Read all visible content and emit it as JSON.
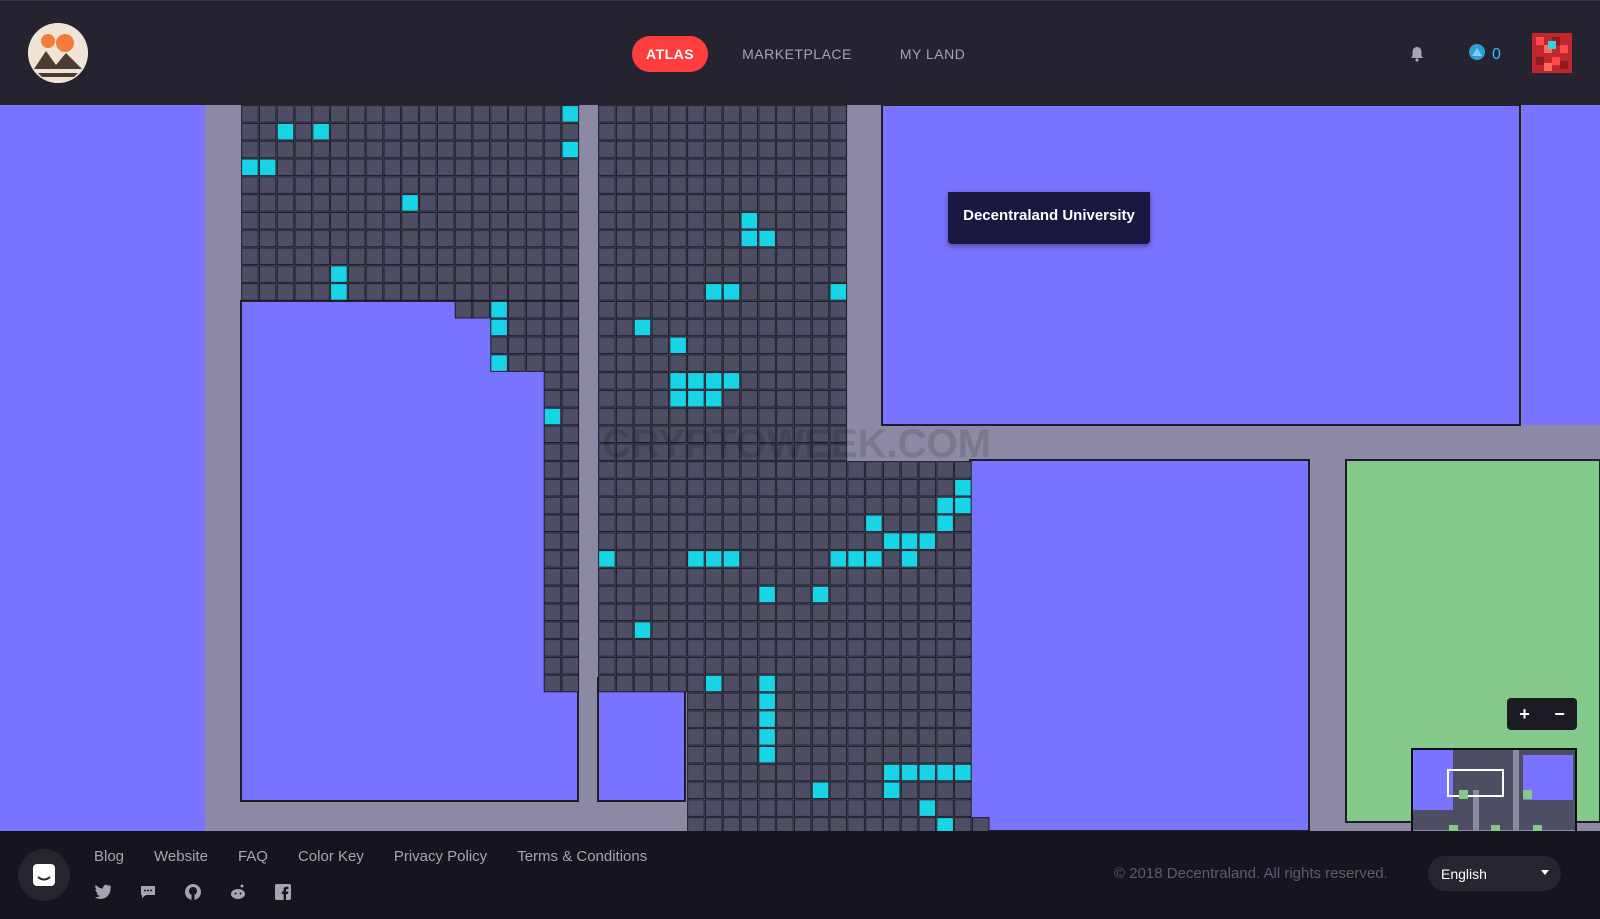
{
  "header": {
    "logo_icon": "decentraland-logo-icon",
    "nav": [
      {
        "label": "ATLAS",
        "active": true
      },
      {
        "label": "MARKETPLACE",
        "active": false
      },
      {
        "label": "MY LAND",
        "active": false
      }
    ],
    "notification_icon": "bell-icon",
    "mana_icon": "mana-icon",
    "mana_balance": "0",
    "avatar_icon": "user-avatar-icon"
  },
  "map": {
    "tooltip": "Decentraland University",
    "watermark": "CRYPTOWEEK.COM",
    "colors": {
      "road": "#8b89a3",
      "district": "#7874ff",
      "plaza": "#82c98a",
      "parcel": "#4d4d63",
      "parcel_border": "#1e1d29",
      "owned_highlight": "#17d4e6"
    },
    "zoom_in_label": "+",
    "zoom_out_label": "−",
    "minimap_icon": "minimap-icon"
  },
  "footer": {
    "chat_icon": "chat-icon",
    "links": [
      "Blog",
      "Website",
      "FAQ",
      "Color Key",
      "Privacy Policy",
      "Terms & Conditions"
    ],
    "social_icons": [
      "twitter-icon",
      "chat-bubble-icon",
      "github-icon",
      "reddit-icon",
      "facebook-icon"
    ],
    "copyright": "© 2018 Decentraland. All rights reserved.",
    "language": "English"
  }
}
